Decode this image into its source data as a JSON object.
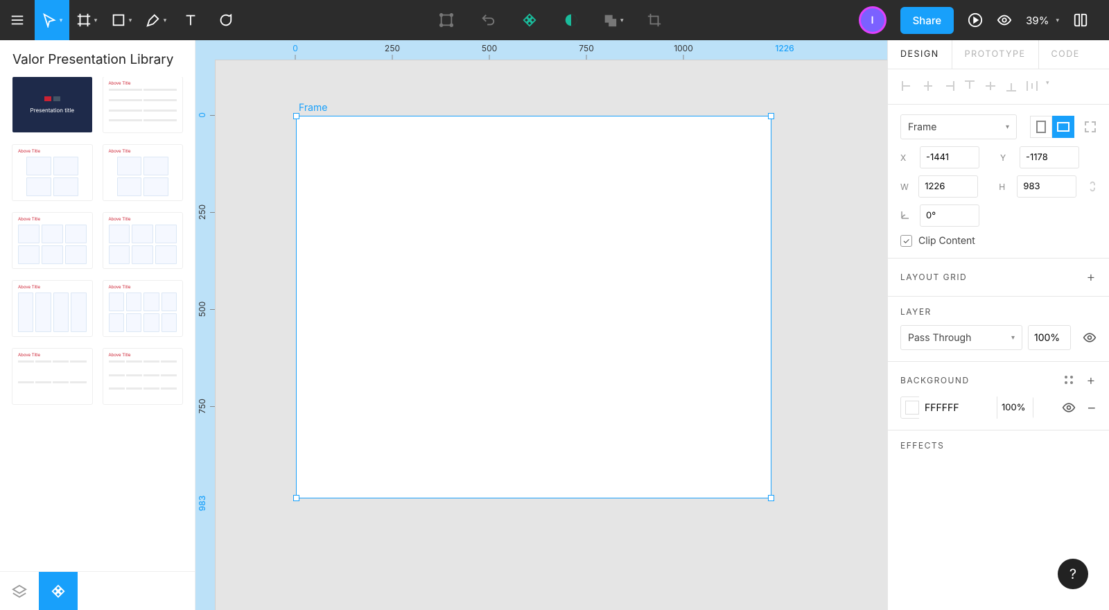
{
  "sidebar": {
    "title": "Valor Presentation Library",
    "thumb_title": "Presentation title",
    "thumb_header": "Above Title"
  },
  "topbar": {
    "avatar_initial": "I",
    "share": "Share",
    "zoom": "39%"
  },
  "canvas": {
    "frame_label": "Frame",
    "hruler": {
      "ticks": [
        "0",
        "250",
        "500",
        "750",
        "1000"
      ],
      "end": "1226"
    },
    "vruler": {
      "ticks": [
        "0",
        "250",
        "500",
        "750"
      ],
      "end": "983"
    }
  },
  "panel": {
    "tabs": [
      "DESIGN",
      "PROTOTYPE",
      "CODE"
    ],
    "frame_type": "Frame",
    "x_label": "X",
    "y_label": "Y",
    "w_label": "W",
    "h_label": "H",
    "x": "-1441",
    "y": "-1178",
    "w": "1226",
    "h": "983",
    "rotation": "0°",
    "clip_label": "Clip Content",
    "layout_grid": "LAYOUT GRID",
    "layer": "LAYER",
    "pass_through": "Pass Through",
    "layer_opacity": "100%",
    "background": "BACKGROUND",
    "bg_hex": "FFFFFF",
    "bg_opacity": "100%",
    "effects": "EFFECTS"
  },
  "help": "?"
}
